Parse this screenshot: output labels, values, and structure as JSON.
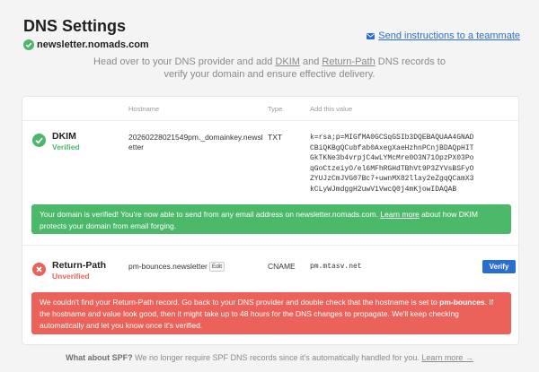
{
  "page": {
    "title": "DNS Settings",
    "domain": "newsletter.nomads.com",
    "send_link": "Send instructions to a teammate",
    "intro_part1": "Head over to your DNS provider and add ",
    "intro_dkim": "DKIM",
    "intro_and": " and ",
    "intro_return_path": "Return-Path",
    "intro_part2": " DNS records to",
    "intro_line2": "verify your domain and ensure effective delivery."
  },
  "table": {
    "headers": {
      "hostname": "Hostname",
      "type": "Type",
      "value": "Add this value"
    }
  },
  "records": {
    "dkim": {
      "name": "DKIM",
      "status": "Verified",
      "hostname_line1": "20260228021549pm._domainkey.newsl",
      "hostname_line2": "etter",
      "type": "TXT",
      "value": "k=rsa;p=MIGfMA0GCSqGSIb3DQEBAQUAA4GNAD\nCBiQKBgQCubfab0AxegXaeHzhnPCnjBDAQpHIT\nGkTKNe3b4vrpjC4wLYMcMre0O3N71OpzPX03Po\nqGoCtzeiyO/el6MFhRGHdTBhVt9P3ZYVsBSFyO\nZYUJzCmJVG07Bc7+uwnMX82llay2eZgqQCamX3\nkCLyWJmdggH2uwV1VwcQ0j4mKjowIDAQAB",
      "banner_text": "Your domain is verified! You're now able to send from any email address on newsletter.nomads.com. ",
      "banner_link": "Learn more",
      "banner_text2": " about how DKIM protects your domain from email forging."
    },
    "return_path": {
      "name": "Return-Path",
      "status": "Unverified",
      "hostname": "pm-bounces.newsletter",
      "edit_label": "Edit",
      "type": "CNAME",
      "value": "pm.mtasv.net",
      "verify_label": "Verify",
      "banner_text1": "We couldn't find your Return-Path record. Go back to your DNS provider and double check that the hostname is set to ",
      "banner_bold": "pm-bounces",
      "banner_text2": ". If the hostname and value look good, then it might take up to 48 hours for the DNS changes to propagate. We'll keep checking automatically and let you know once it's verified."
    }
  },
  "footer": {
    "question": "What about SPF?",
    "text": " We no longer require SPF DNS records since it's automatically handled for you. ",
    "link": "Learn more →"
  },
  "colors": {
    "verified": "#4cb86a",
    "unverified": "#ea6259",
    "accent": "#2a6fd0"
  },
  "icons": {
    "domain_badge": "verified-badge-icon",
    "send": "mail-icon",
    "dkim_status": "checkmark-circle-icon",
    "return_path_status": "x-circle-icon"
  }
}
